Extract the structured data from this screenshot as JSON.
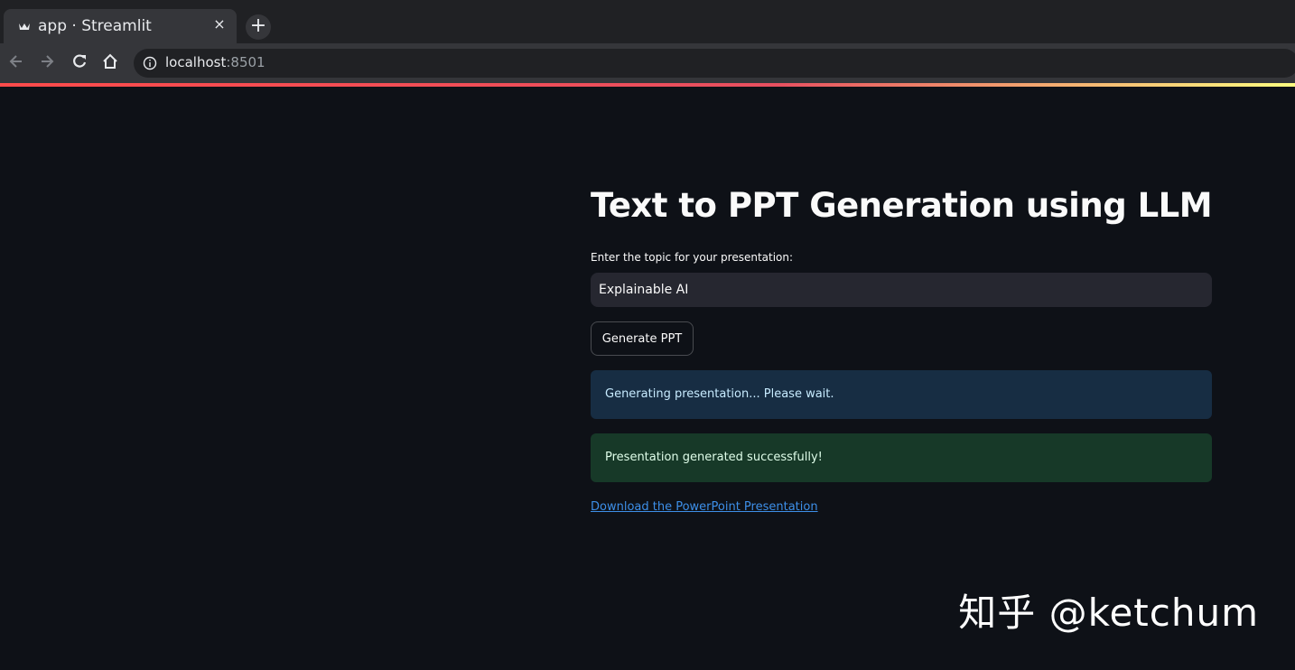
{
  "browser": {
    "tab_title": "app · Streamlit",
    "tab_close": "×",
    "new_tab": "+",
    "url_host": "localhost",
    "url_port": ":8501"
  },
  "app": {
    "title": "Text to PPT Generation using LLM",
    "topic_label": "Enter the topic for your presentation:",
    "topic_value": "Explainable AI",
    "generate_label": "Generate PPT",
    "info_message": "Generating presentation... Please wait.",
    "success_message": "Presentation generated successfully!",
    "download_link": "Download the PowerPoint Presentation"
  },
  "watermark": "知乎 @ketchum",
  "colors": {
    "background": "#0e1117",
    "input_bg": "#262730",
    "info_bg": "#172d43",
    "success_bg": "#173928",
    "link": "#3d8fe8",
    "accent": "#ff4b4b"
  },
  "icons": {
    "favicon": "streamlit-crown-icon",
    "back": "arrow-left-icon",
    "forward": "arrow-right-icon",
    "reload": "reload-icon",
    "home": "home-icon",
    "site_info": "info-icon"
  }
}
